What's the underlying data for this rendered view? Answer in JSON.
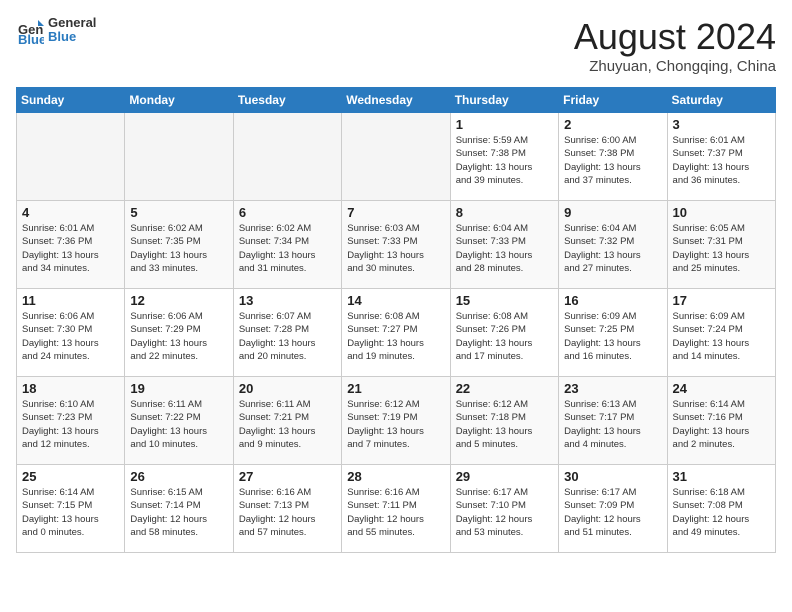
{
  "header": {
    "logo_general": "General",
    "logo_blue": "Blue",
    "month_year": "August 2024",
    "location": "Zhuyuan, Chongqing, China"
  },
  "weekdays": [
    "Sunday",
    "Monday",
    "Tuesday",
    "Wednesday",
    "Thursday",
    "Friday",
    "Saturday"
  ],
  "weeks": [
    [
      {
        "day": "",
        "info": ""
      },
      {
        "day": "",
        "info": ""
      },
      {
        "day": "",
        "info": ""
      },
      {
        "day": "",
        "info": ""
      },
      {
        "day": "1",
        "info": "Sunrise: 5:59 AM\nSunset: 7:38 PM\nDaylight: 13 hours\nand 39 minutes."
      },
      {
        "day": "2",
        "info": "Sunrise: 6:00 AM\nSunset: 7:38 PM\nDaylight: 13 hours\nand 37 minutes."
      },
      {
        "day": "3",
        "info": "Sunrise: 6:01 AM\nSunset: 7:37 PM\nDaylight: 13 hours\nand 36 minutes."
      }
    ],
    [
      {
        "day": "4",
        "info": "Sunrise: 6:01 AM\nSunset: 7:36 PM\nDaylight: 13 hours\nand 34 minutes."
      },
      {
        "day": "5",
        "info": "Sunrise: 6:02 AM\nSunset: 7:35 PM\nDaylight: 13 hours\nand 33 minutes."
      },
      {
        "day": "6",
        "info": "Sunrise: 6:02 AM\nSunset: 7:34 PM\nDaylight: 13 hours\nand 31 minutes."
      },
      {
        "day": "7",
        "info": "Sunrise: 6:03 AM\nSunset: 7:33 PM\nDaylight: 13 hours\nand 30 minutes."
      },
      {
        "day": "8",
        "info": "Sunrise: 6:04 AM\nSunset: 7:33 PM\nDaylight: 13 hours\nand 28 minutes."
      },
      {
        "day": "9",
        "info": "Sunrise: 6:04 AM\nSunset: 7:32 PM\nDaylight: 13 hours\nand 27 minutes."
      },
      {
        "day": "10",
        "info": "Sunrise: 6:05 AM\nSunset: 7:31 PM\nDaylight: 13 hours\nand 25 minutes."
      }
    ],
    [
      {
        "day": "11",
        "info": "Sunrise: 6:06 AM\nSunset: 7:30 PM\nDaylight: 13 hours\nand 24 minutes."
      },
      {
        "day": "12",
        "info": "Sunrise: 6:06 AM\nSunset: 7:29 PM\nDaylight: 13 hours\nand 22 minutes."
      },
      {
        "day": "13",
        "info": "Sunrise: 6:07 AM\nSunset: 7:28 PM\nDaylight: 13 hours\nand 20 minutes."
      },
      {
        "day": "14",
        "info": "Sunrise: 6:08 AM\nSunset: 7:27 PM\nDaylight: 13 hours\nand 19 minutes."
      },
      {
        "day": "15",
        "info": "Sunrise: 6:08 AM\nSunset: 7:26 PM\nDaylight: 13 hours\nand 17 minutes."
      },
      {
        "day": "16",
        "info": "Sunrise: 6:09 AM\nSunset: 7:25 PM\nDaylight: 13 hours\nand 16 minutes."
      },
      {
        "day": "17",
        "info": "Sunrise: 6:09 AM\nSunset: 7:24 PM\nDaylight: 13 hours\nand 14 minutes."
      }
    ],
    [
      {
        "day": "18",
        "info": "Sunrise: 6:10 AM\nSunset: 7:23 PM\nDaylight: 13 hours\nand 12 minutes."
      },
      {
        "day": "19",
        "info": "Sunrise: 6:11 AM\nSunset: 7:22 PM\nDaylight: 13 hours\nand 10 minutes."
      },
      {
        "day": "20",
        "info": "Sunrise: 6:11 AM\nSunset: 7:21 PM\nDaylight: 13 hours\nand 9 minutes."
      },
      {
        "day": "21",
        "info": "Sunrise: 6:12 AM\nSunset: 7:19 PM\nDaylight: 13 hours\nand 7 minutes."
      },
      {
        "day": "22",
        "info": "Sunrise: 6:12 AM\nSunset: 7:18 PM\nDaylight: 13 hours\nand 5 minutes."
      },
      {
        "day": "23",
        "info": "Sunrise: 6:13 AM\nSunset: 7:17 PM\nDaylight: 13 hours\nand 4 minutes."
      },
      {
        "day": "24",
        "info": "Sunrise: 6:14 AM\nSunset: 7:16 PM\nDaylight: 13 hours\nand 2 minutes."
      }
    ],
    [
      {
        "day": "25",
        "info": "Sunrise: 6:14 AM\nSunset: 7:15 PM\nDaylight: 13 hours\nand 0 minutes."
      },
      {
        "day": "26",
        "info": "Sunrise: 6:15 AM\nSunset: 7:14 PM\nDaylight: 12 hours\nand 58 minutes."
      },
      {
        "day": "27",
        "info": "Sunrise: 6:16 AM\nSunset: 7:13 PM\nDaylight: 12 hours\nand 57 minutes."
      },
      {
        "day": "28",
        "info": "Sunrise: 6:16 AM\nSunset: 7:11 PM\nDaylight: 12 hours\nand 55 minutes."
      },
      {
        "day": "29",
        "info": "Sunrise: 6:17 AM\nSunset: 7:10 PM\nDaylight: 12 hours\nand 53 minutes."
      },
      {
        "day": "30",
        "info": "Sunrise: 6:17 AM\nSunset: 7:09 PM\nDaylight: 12 hours\nand 51 minutes."
      },
      {
        "day": "31",
        "info": "Sunrise: 6:18 AM\nSunset: 7:08 PM\nDaylight: 12 hours\nand 49 minutes."
      }
    ]
  ]
}
